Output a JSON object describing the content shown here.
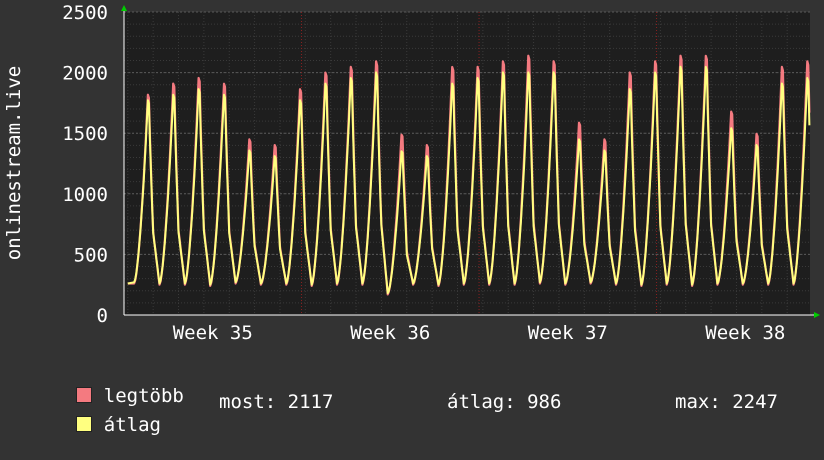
{
  "chart_data": {
    "type": "line",
    "ylabel": "onlinestream.live",
    "ylim": [
      0,
      2500
    ],
    "y_ticks": [
      "0",
      "500",
      "1000",
      "1500",
      "2000",
      "2500"
    ],
    "x_ticks": [
      "Week 35",
      "Week 36",
      "Week 37",
      "Week 38"
    ],
    "grid": true,
    "legend_placement": "bottom-left",
    "colors": {
      "background": "#333333",
      "plot_background": "#1e1e1e",
      "grid": "#4a4a4a",
      "max_series": "#f47a80",
      "avg_series": "#ffff80",
      "axis_arrow": "#00cc00"
    },
    "daily": {
      "peak_max": [
        1950,
        2050,
        2100,
        2050,
        1550,
        1500,
        2000,
        2150,
        2200,
        2250,
        1600,
        1500,
        2200,
        2200,
        2250,
        2300,
        2250,
        1700,
        1550,
        2150,
        2250,
        2300,
        2300,
        1800,
        1600,
        2200,
        2250
      ],
      "peak_avg": [
        1900,
        1950,
        2000,
        1950,
        1450,
        1400,
        1900,
        2050,
        2100,
        2150,
        1450,
        1400,
        2050,
        2100,
        2150,
        2150,
        2150,
        1550,
        1450,
        2000,
        2150,
        2200,
        2200,
        1650,
        1500,
        2050,
        2100
      ],
      "trough": [
        260,
        250,
        250,
        240,
        260,
        250,
        250,
        240,
        250,
        250,
        170,
        250,
        240,
        250,
        250,
        250,
        260,
        250,
        260,
        250,
        240,
        250,
        240,
        250,
        250,
        250,
        250
      ]
    },
    "series": [
      {
        "name": "legtöbb",
        "color": "#f47a80"
      },
      {
        "name": "átlag",
        "color": "#ffff80"
      }
    ]
  },
  "legend": {
    "max_label": "legtöbb",
    "avg_label": "átlag"
  },
  "stats": {
    "current": "most: 2117",
    "average": "átlag: 986",
    "maximum": "max: 2247"
  }
}
